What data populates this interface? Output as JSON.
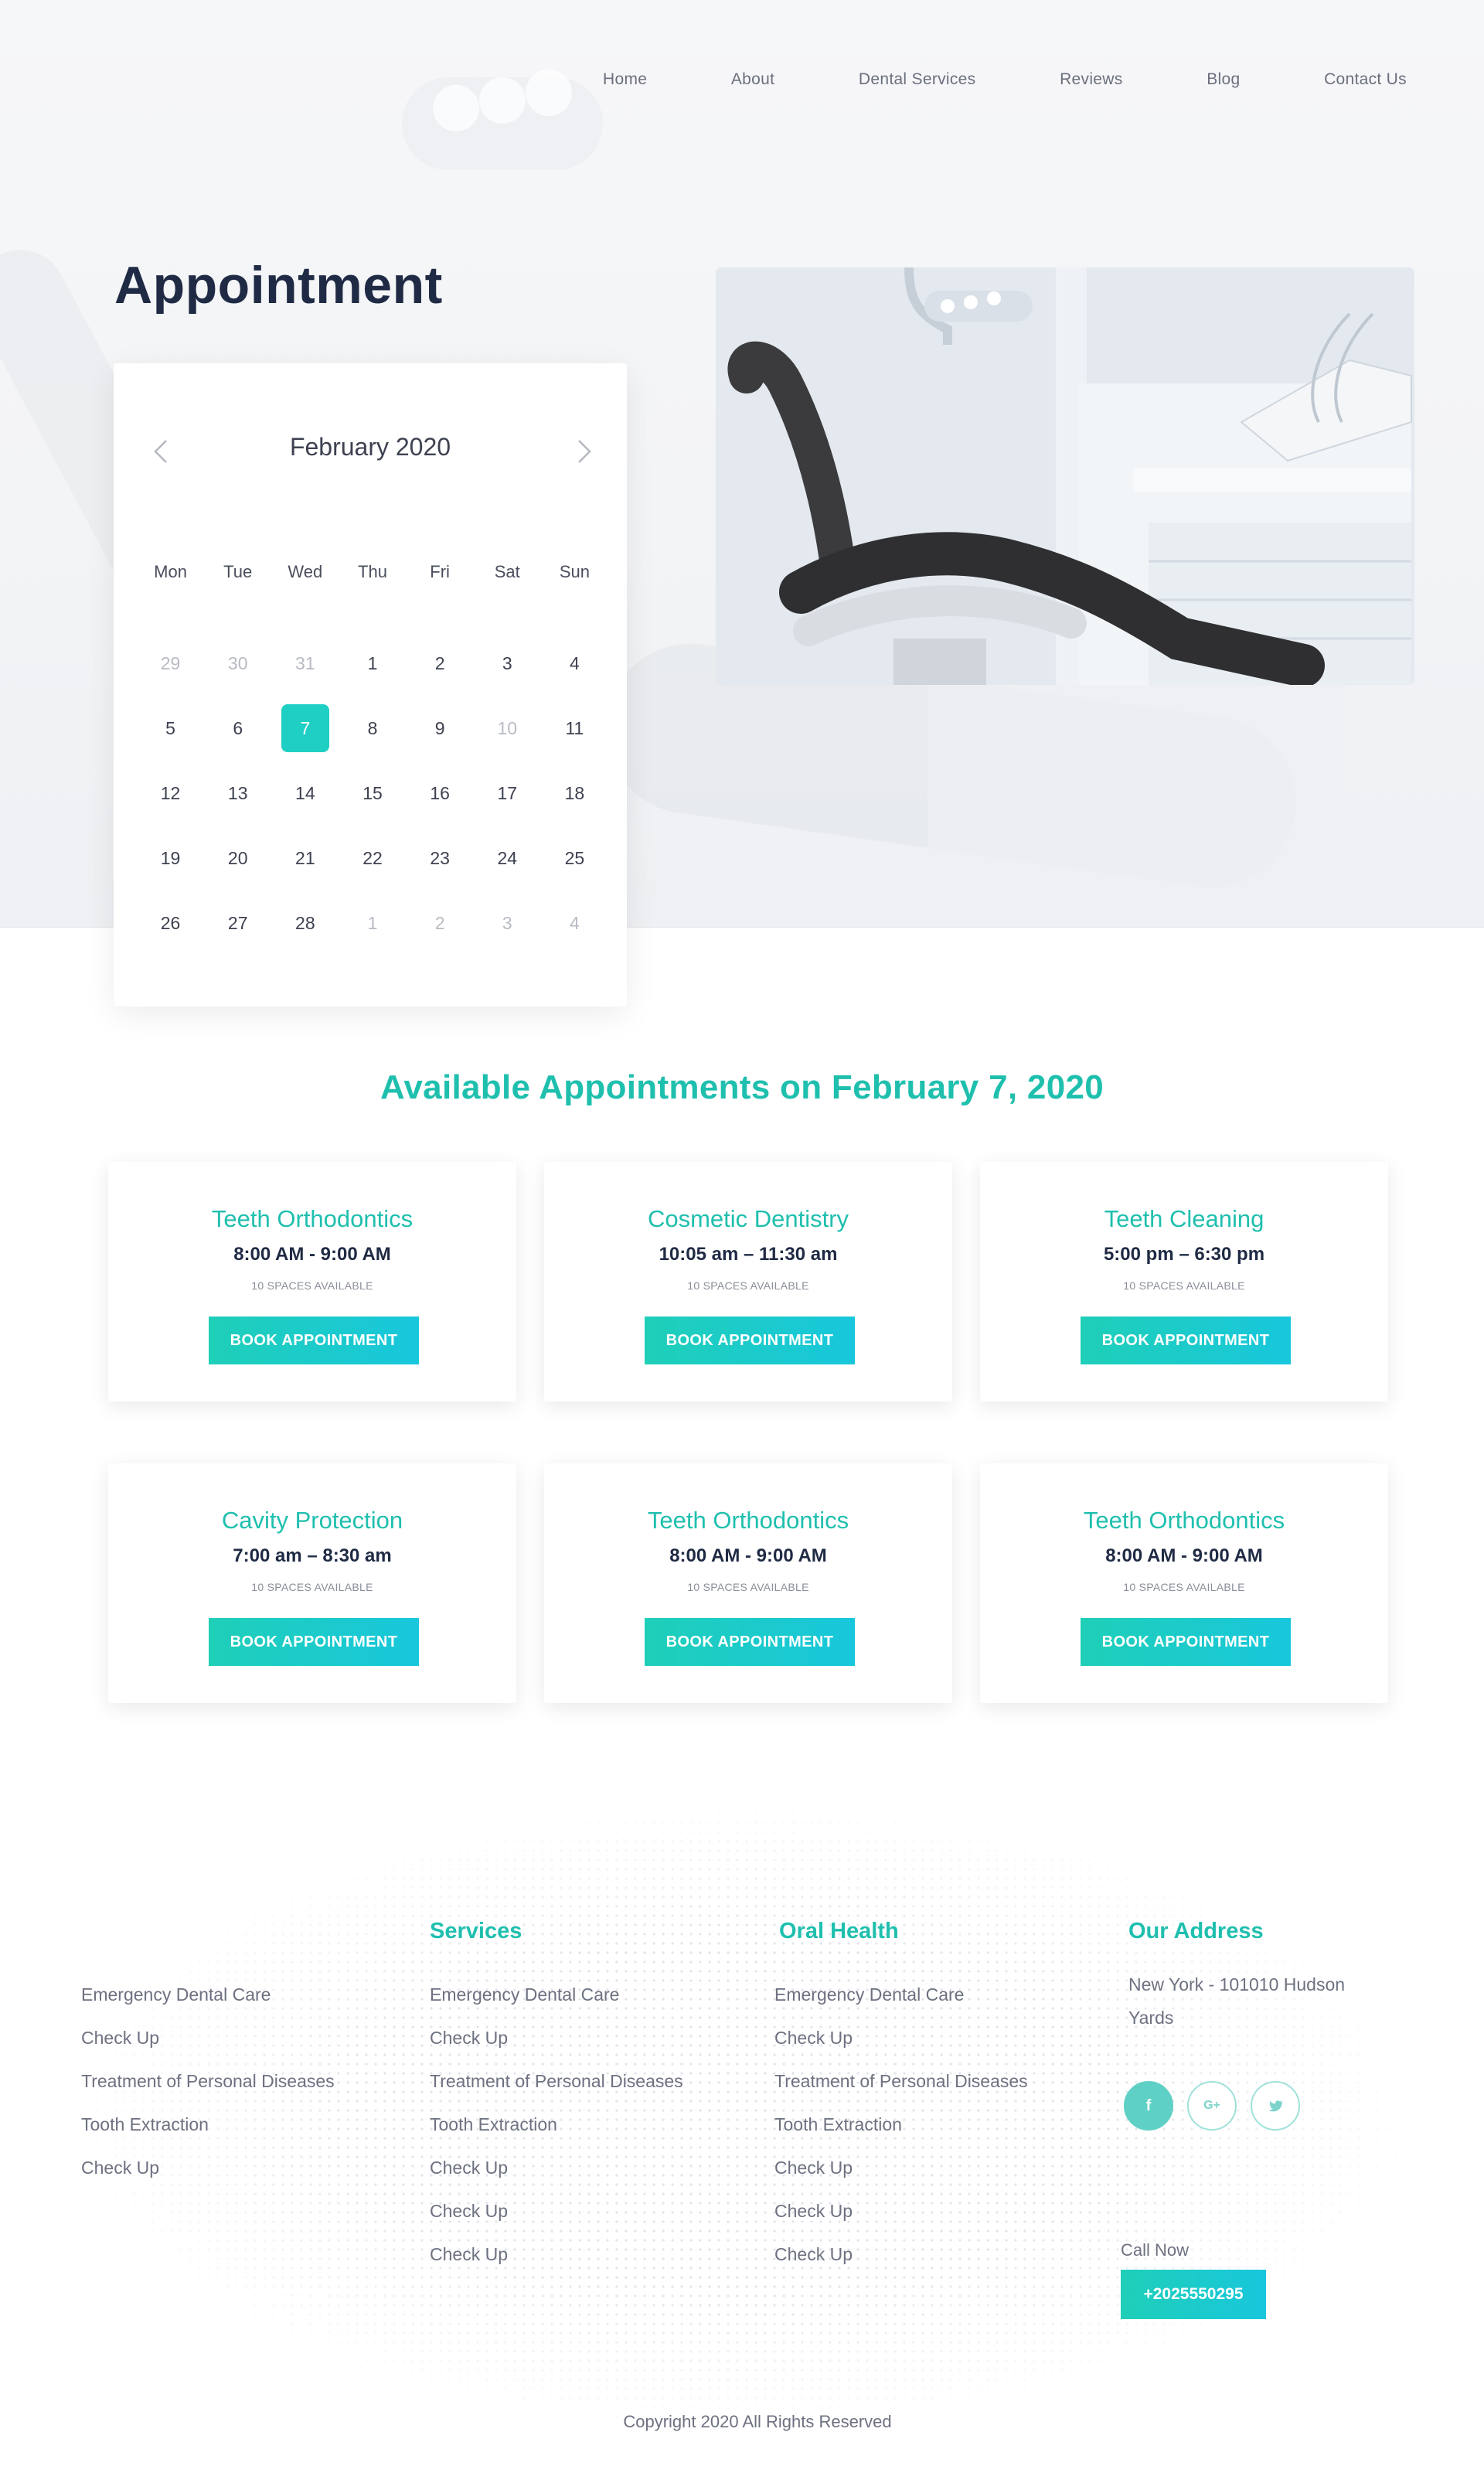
{
  "nav": {
    "items": [
      {
        "label": "Home"
      },
      {
        "label": "About"
      },
      {
        "label": "Dental Services"
      },
      {
        "label": "Reviews"
      },
      {
        "label": "Blog"
      },
      {
        "label": "Contact Us"
      }
    ]
  },
  "page_title": "Appointment",
  "calendar": {
    "month_label": "February 2020",
    "weekdays": [
      "Mon",
      "Tue",
      "Wed",
      "Thu",
      "Fri",
      "Sat",
      "Sun"
    ],
    "selected_day": "7",
    "weeks": [
      [
        {
          "d": "29",
          "muted": true
        },
        {
          "d": "30",
          "muted": true
        },
        {
          "d": "31",
          "muted": true
        },
        {
          "d": "1"
        },
        {
          "d": "2"
        },
        {
          "d": "3"
        },
        {
          "d": "4"
        }
      ],
      [
        {
          "d": "5"
        },
        {
          "d": "6"
        },
        {
          "d": "7",
          "selected": true
        },
        {
          "d": "8"
        },
        {
          "d": "9"
        },
        {
          "d": "10",
          "muted": true
        },
        {
          "d": "11"
        }
      ],
      [
        {
          "d": "12"
        },
        {
          "d": "13"
        },
        {
          "d": "14"
        },
        {
          "d": "15"
        },
        {
          "d": "16"
        },
        {
          "d": "17"
        },
        {
          "d": "18"
        }
      ],
      [
        {
          "d": "19"
        },
        {
          "d": "20"
        },
        {
          "d": "21"
        },
        {
          "d": "22"
        },
        {
          "d": "23"
        },
        {
          "d": "24"
        },
        {
          "d": "25"
        }
      ],
      [
        {
          "d": "26"
        },
        {
          "d": "27"
        },
        {
          "d": "28"
        },
        {
          "d": "1",
          "muted": true
        },
        {
          "d": "2",
          "muted": true
        },
        {
          "d": "3",
          "muted": true
        },
        {
          "d": "4",
          "muted": true
        }
      ]
    ]
  },
  "available": {
    "title": "Available Appointments on February 7, 2020",
    "cards": [
      {
        "title": "Teeth Orthodontics",
        "time": "8:00 AM - 9:00 AM",
        "spaces": "10 SPACES AVAILABLE",
        "button": "BOOK APPOINTMENT"
      },
      {
        "title": "Cosmetic Dentistry",
        "time": "10:05 am – 11:30 am",
        "spaces": "10 SPACES AVAILABLE",
        "button": "BOOK APPOINTMENT"
      },
      {
        "title": "Teeth Cleaning",
        "time": "5:00 pm – 6:30 pm",
        "spaces": "10 SPACES AVAILABLE",
        "button": "BOOK APPOINTMENT"
      },
      {
        "title": "Cavity Protection",
        "time": "7:00 am – 8:30 am",
        "spaces": "10 SPACES AVAILABLE",
        "button": "BOOK APPOINTMENT"
      },
      {
        "title": "Teeth Orthodontics",
        "time": "8:00 AM - 9:00 AM",
        "spaces": "10 SPACES AVAILABLE",
        "button": "BOOK APPOINTMENT"
      },
      {
        "title": "Teeth Orthodontics",
        "time": "8:00 AM - 9:00 AM",
        "spaces": "10 SPACES AVAILABLE",
        "button": "BOOK APPOINTMENT"
      }
    ]
  },
  "footer": {
    "col1": {
      "heading": "",
      "links": [
        "Emergency Dental Care",
        "Check Up",
        "Treatment of Personal Diseases",
        "Tooth Extraction",
        "Check Up"
      ]
    },
    "col2": {
      "heading": "Services",
      "links": [
        "Emergency Dental Care",
        "Check Up",
        "Treatment of Personal Diseases",
        "Tooth Extraction",
        "Check Up",
        "Check Up",
        "Check Up"
      ]
    },
    "col3": {
      "heading": "Oral Health",
      "links": [
        "Emergency Dental Care",
        "Check Up",
        "Treatment of Personal Diseases",
        "Tooth Extraction",
        "Check Up",
        "Check Up",
        "Check Up"
      ]
    },
    "col4": {
      "heading": "Our Address",
      "address_line1": "New York - 101010 Hudson",
      "address_line2": "Yards",
      "socials": [
        {
          "icon": "facebook-icon",
          "glyph": "f"
        },
        {
          "icon": "google-plus-icon",
          "glyph": "G+"
        },
        {
          "icon": "twitter-icon",
          "glyph": ""
        }
      ],
      "call_label": "Call Now",
      "phone": "+2025550295"
    },
    "copyright": "Copyright 2020 All Rights Reserved"
  },
  "colors": {
    "accent": "#1fbfae",
    "accent_button_start": "#1fcfb8",
    "accent_button_end": "#18c7dc",
    "heading_dark": "#1f2a44"
  }
}
